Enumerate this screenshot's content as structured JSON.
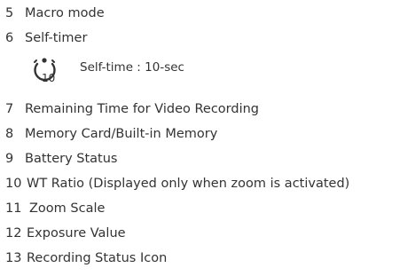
{
  "items": [
    {
      "num": "5",
      "label": "Macro mode"
    },
    {
      "num": "6",
      "label": "Self-timer"
    },
    {
      "num": "7",
      "label": "Remaining Time for Video Recording"
    },
    {
      "num": "8",
      "label": "Memory Card/Built-in Memory"
    },
    {
      "num": "9",
      "label": "Battery Status"
    },
    {
      "num": "10",
      "label": "WT Ratio (Displayed only when zoom is activated)"
    },
    {
      "num": "11",
      "label": "Zoom Scale"
    },
    {
      "num": "12",
      "label": "Exposure Value"
    },
    {
      "num": "13",
      "label": "Recording Status Icon"
    }
  ],
  "self_timer_sub": {
    "icon": "self-timer-10sec-icon",
    "icon_text": "10",
    "label": "Self-time : 10-sec"
  }
}
